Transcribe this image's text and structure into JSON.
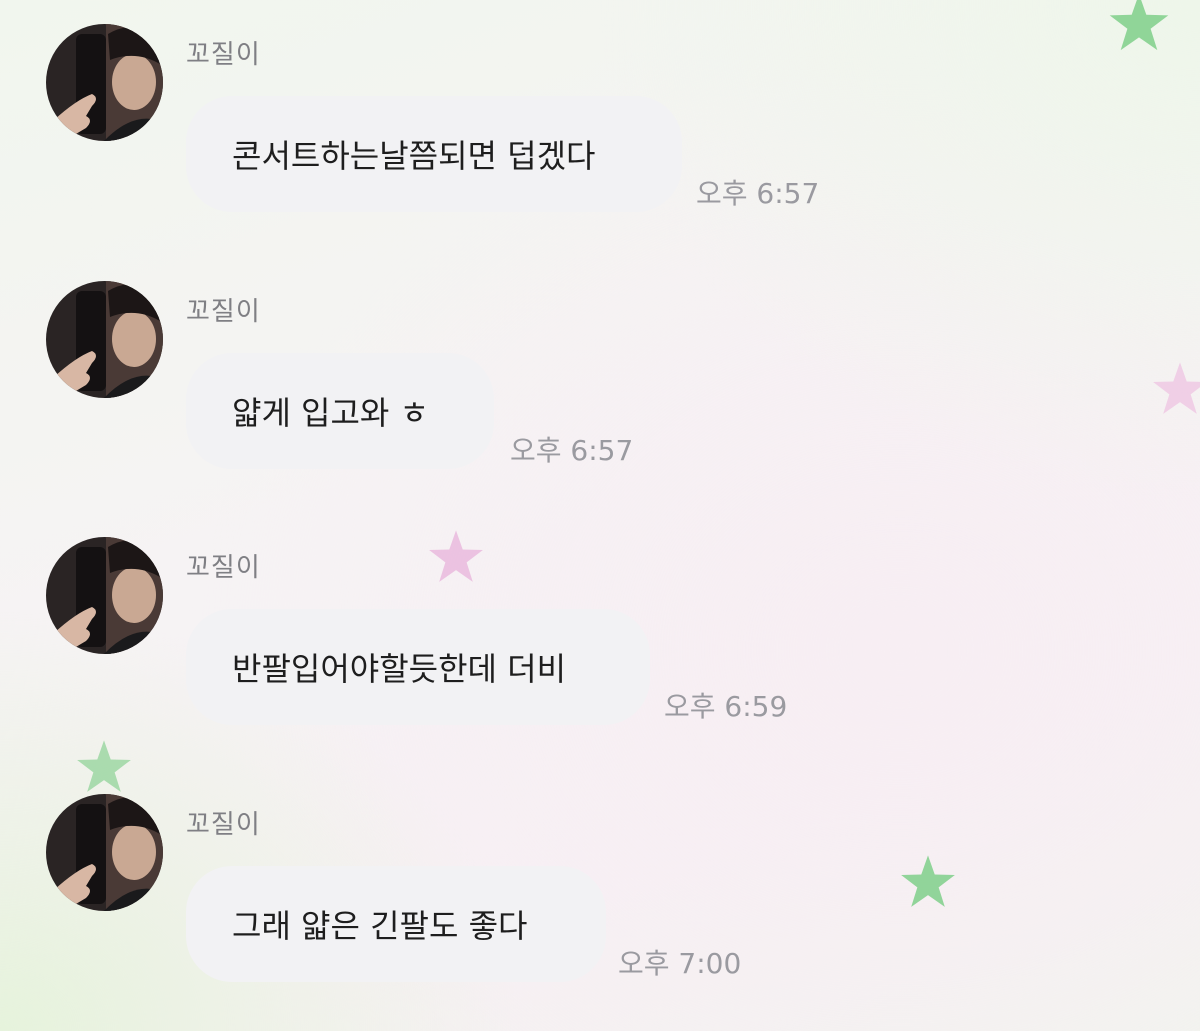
{
  "chat": {
    "messages": [
      {
        "sender": "꼬질이",
        "text": "콘서트하는날쯤되면 덥겠다",
        "time": "오후 6:57"
      },
      {
        "sender": "꼬질이",
        "text": "얇게 입고와 ㅎ",
        "time": "오후 6:57"
      },
      {
        "sender": "꼬질이",
        "text": "반팔입어야할듯한데 더비",
        "time": "오후 6:59"
      },
      {
        "sender": "꼬질이",
        "text": "그래 얇은 긴팔도 좋다",
        "time": "오후 7:00"
      }
    ]
  },
  "decor": {
    "star_green": "#7fcf8a",
    "star_pink": "#e9b6dc"
  }
}
